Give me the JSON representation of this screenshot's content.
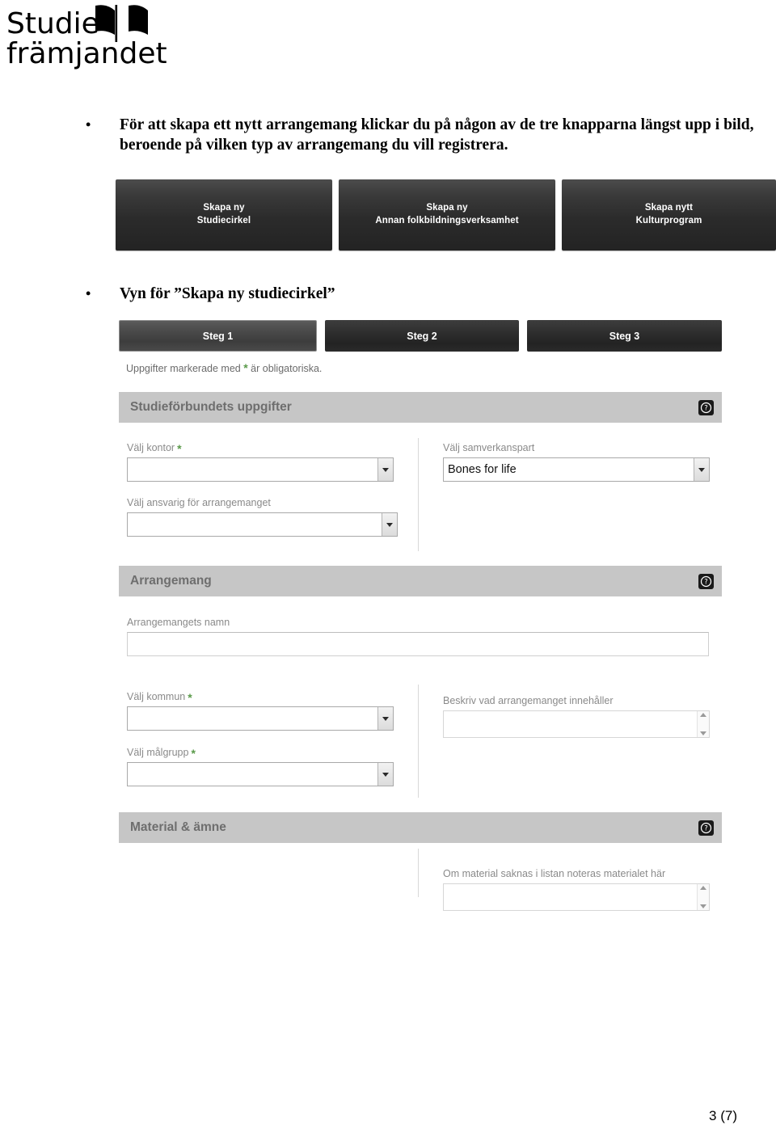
{
  "logo": {
    "line1": "Studie",
    "line2": "främjandet",
    "icon": "open-book-icon"
  },
  "document": {
    "bullets": [
      {
        "text": "För att skapa ett nytt arrangemang klickar du på någon av de tre knapparna längst upp i bild, beroende på vilken typ av arrangemang du vill registrera."
      },
      {
        "text": "Vyn för ”Skapa ny studiecirkel”"
      }
    ],
    "footer_page": "3 (7)"
  },
  "create_buttons": [
    {
      "line1": "Skapa ny",
      "line2": "Studiecirkel"
    },
    {
      "line1": "Skapa ny",
      "line2": "Annan folkbildningsverksamhet"
    },
    {
      "line1": "Skapa nytt",
      "line2": "Kulturprogram"
    }
  ],
  "form": {
    "steps": [
      {
        "label": "Steg 1",
        "active": true
      },
      {
        "label": "Steg 2",
        "active": false
      },
      {
        "label": "Steg 3",
        "active": false
      }
    ],
    "required_note": {
      "before": "Uppgifter markerade med",
      "star": "*",
      "after": "är obligatoriska."
    },
    "sections": [
      {
        "title": "Studieförbundets uppgifter",
        "help_icon": "question-mark-icon"
      },
      {
        "title": "Arrangemang",
        "help_icon": "question-mark-icon"
      },
      {
        "title": "Material & ämne",
        "help_icon": "question-mark-icon"
      }
    ],
    "fields": {
      "valj_kontor": {
        "label": "Välj kontor",
        "required": "*",
        "value": "",
        "control": "dropdown"
      },
      "valj_samverkanspart": {
        "label": "Välj samverkanspart",
        "required": "",
        "value": "Bones for life",
        "control": "dropdown"
      },
      "valj_ansvarig": {
        "label": "Välj ansvarig för arrangemanget",
        "required": "",
        "value": "",
        "control": "dropdown"
      },
      "arrangemangets_namn": {
        "label": "Arrangemangets namn",
        "required": "",
        "value": "",
        "control": "text"
      },
      "valj_kommun": {
        "label": "Välj kommun",
        "required": "*",
        "value": "",
        "control": "dropdown"
      },
      "beskriv_arrangemang": {
        "label": "Beskriv vad arrangemanget innehåller",
        "required": "",
        "value": "",
        "control": "textarea"
      },
      "valj_malgrupp": {
        "label": "Välj målgrupp",
        "required": "*",
        "value": "",
        "control": "dropdown"
      },
      "om_material_saknas": {
        "label": "Om material saknas i listan noteras materialet här",
        "required": "",
        "value": "",
        "control": "textarea"
      }
    }
  },
  "colors": {
    "required_star": "#5a9a4a",
    "section_header_bg": "#c6c6c6",
    "section_header_text": "#6e6e6e",
    "field_label": "#8a8a8a",
    "button_dark": "#2b2b2b"
  }
}
